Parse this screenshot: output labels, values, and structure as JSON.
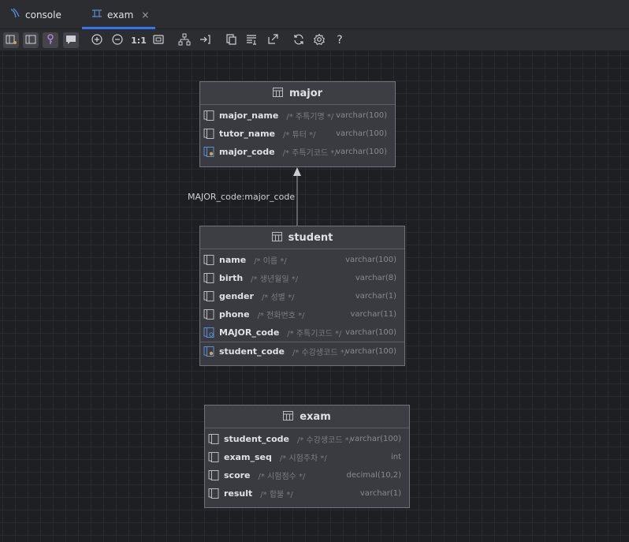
{
  "tabs": [
    {
      "label": "console",
      "icon": "database-console-icon"
    },
    {
      "label": "exam",
      "icon": "diagram-icon",
      "close": "×"
    }
  ],
  "toolbar": {
    "zoom_actual": "1:1",
    "help": "?"
  },
  "relation": {
    "label": "MAJOR_code:major_code"
  },
  "entities": {
    "major": {
      "title": "major",
      "columns": [
        {
          "name": "major_name",
          "comment": "/* 주특기명 */",
          "type": "varchar(100)",
          "icon": "column-icon"
        },
        {
          "name": "tutor_name",
          "comment": "/* 튜터 */",
          "type": "varchar(100)",
          "icon": "column-icon"
        },
        {
          "name": "major_code",
          "comment": "/* 주특기코드 */",
          "type": "varchar(100)",
          "icon": "primary-key-column-icon"
        }
      ]
    },
    "student": {
      "title": "student",
      "columns": [
        {
          "name": "name",
          "comment": "/* 이름 */",
          "type": "varchar(100)",
          "icon": "column-icon"
        },
        {
          "name": "birth",
          "comment": "/* 생년월일 */",
          "type": "varchar(8)",
          "icon": "column-icon"
        },
        {
          "name": "gender",
          "comment": "/* 성별 */",
          "type": "varchar(1)",
          "icon": "column-icon"
        },
        {
          "name": "phone",
          "comment": "/* 전화번호 */",
          "type": "varchar(11)",
          "icon": "column-icon"
        },
        {
          "name": "MAJOR_code",
          "comment": "/* 주특기코드 */",
          "type": "varchar(100)",
          "icon": "foreign-key-column-icon"
        },
        {
          "name": "student_code",
          "comment": "/* 수강생코드 */",
          "type": "varchar(100)",
          "icon": "primary-key-column-icon"
        }
      ]
    },
    "exam": {
      "title": "exam",
      "columns": [
        {
          "name": "student_code",
          "comment": "/* 수강생코드 */",
          "type": "varchar(100)",
          "icon": "column-icon"
        },
        {
          "name": "exam_seq",
          "comment": "/* 시험주차 */",
          "type": "int",
          "icon": "column-icon"
        },
        {
          "name": "score",
          "comment": "/* 시험점수 */",
          "type": "decimal(10,2)",
          "icon": "column-icon"
        },
        {
          "name": "result",
          "comment": "/* 합불 */",
          "type": "varchar(1)",
          "icon": "column-icon"
        }
      ]
    }
  },
  "colors": {
    "accent": "#3574f0",
    "key": "#d9a343",
    "fk": "#5a8fd6"
  }
}
